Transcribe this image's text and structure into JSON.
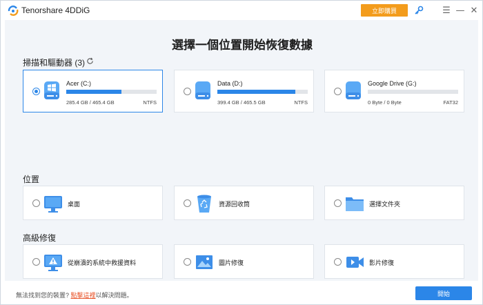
{
  "titlebar": {
    "app_title": "Tenorshare 4DDiG",
    "buy_label": "立即購買",
    "menu_glyph": "☰",
    "minimize_glyph": "—",
    "close_glyph": "✕"
  },
  "main": {
    "heading": "選擇一個位置開始恢復數據"
  },
  "drives_section": {
    "title": "掃描和驅動器 (3)",
    "drives": [
      {
        "name": "Acer (C:)",
        "size": "285.4 GB / 465.4 GB",
        "fs": "NTFS",
        "used_fraction": 0.61,
        "selected": true
      },
      {
        "name": "Data (D:)",
        "size": "399.4 GB / 465.5 GB",
        "fs": "NTFS",
        "used_fraction": 0.86,
        "selected": false
      },
      {
        "name": "Google Drive (G:)",
        "size": "0 Byte / 0 Byte",
        "fs": "FAT32",
        "used_fraction": 0,
        "selected": false
      }
    ]
  },
  "location_section": {
    "title": "位置",
    "items": [
      {
        "label": "桌面",
        "icon": "desktop-icon"
      },
      {
        "label": "資源回收筒",
        "icon": "recycle-bin-icon"
      },
      {
        "label": "選擇文件夾",
        "icon": "folder-icon"
      }
    ]
  },
  "advanced_section": {
    "title": "高級修復",
    "items": [
      {
        "label": "從崩潰的系統中救援資料",
        "icon": "crashed-system-icon"
      },
      {
        "label": "圖片修復",
        "icon": "photo-repair-icon"
      },
      {
        "label": "影片修復",
        "icon": "video-repair-icon"
      }
    ]
  },
  "footer": {
    "prefix": "無法找到您的裝置? ",
    "link": "點擊這裡",
    "suffix": "以解決問題。",
    "start_label": "開始"
  },
  "colors": {
    "accent": "#2b86e8",
    "buy": "#f39c1c",
    "link": "#e8542a"
  }
}
